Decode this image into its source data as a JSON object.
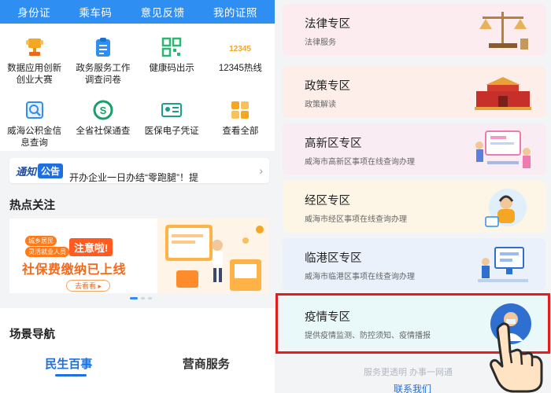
{
  "top_nav": [
    "身份证",
    "乘车码",
    "意见反馈",
    "我的证照"
  ],
  "grid": [
    {
      "label": "数据应用创新创业大赛",
      "icon": "trophy-icon"
    },
    {
      "label": "政务服务工作调查问卷",
      "icon": "clipboard-icon"
    },
    {
      "label": "健康码出示",
      "icon": "qrcode-icon"
    },
    {
      "label": "12345热线",
      "icon": "hotline-icon"
    },
    {
      "label": "威海公积金信息查询",
      "icon": "fund-search-icon"
    },
    {
      "label": "全省社保通查",
      "icon": "social-security-icon"
    },
    {
      "label": "医保电子凭证",
      "icon": "medical-card-icon"
    },
    {
      "label": "查看全部",
      "icon": "grid-all-icon"
    }
  ],
  "notice": {
    "tag1": "通知",
    "tag2": "公告",
    "text": "开办企业一日办结“零跑腿”！提"
  },
  "hot": {
    "title": "热点关注",
    "chip1": "城乡居民",
    "chip2": "灵活就业人员",
    "attention": "注意啦!",
    "headline": "社保费缴纳已上线",
    "button": "去看看 ▸"
  },
  "scene": {
    "title": "场景导航",
    "tabs": [
      "民生百事",
      "营商服务"
    ],
    "active": 0
  },
  "zones": [
    {
      "title": "法律专区",
      "subtitle": "法律服务",
      "bg": "#fcecef",
      "icon": "scales-icon"
    },
    {
      "title": "政策专区",
      "subtitle": "政策解读",
      "bg": "#fdeeea",
      "icon": "gate-building-icon"
    },
    {
      "title": "高新区专区",
      "subtitle": "威海市高新区事项在线查询办理",
      "bg": "#f9ecf3",
      "icon": "desk-people-icon"
    },
    {
      "title": "经区专区",
      "subtitle": "威海市经区事项在线查询办理",
      "bg": "#fdf6e6",
      "icon": "service-agent-icon"
    },
    {
      "title": "临港区专区",
      "subtitle": "威海市临港区事项在线查询办理",
      "bg": "#eaf1fb",
      "icon": "computer-people-icon"
    },
    {
      "title": "疫情专区",
      "subtitle": "提供疫情监测、防控须知、疫情播报",
      "bg": "#e9f8f9",
      "icon": "doctor-icon"
    }
  ],
  "footer": {
    "slogan": "服务更透明 办事一网通",
    "contact": "联系我们"
  },
  "colors": {
    "brand": "#2f8ef2",
    "accent": "#1e6fe0",
    "highlight": "#e02020"
  }
}
